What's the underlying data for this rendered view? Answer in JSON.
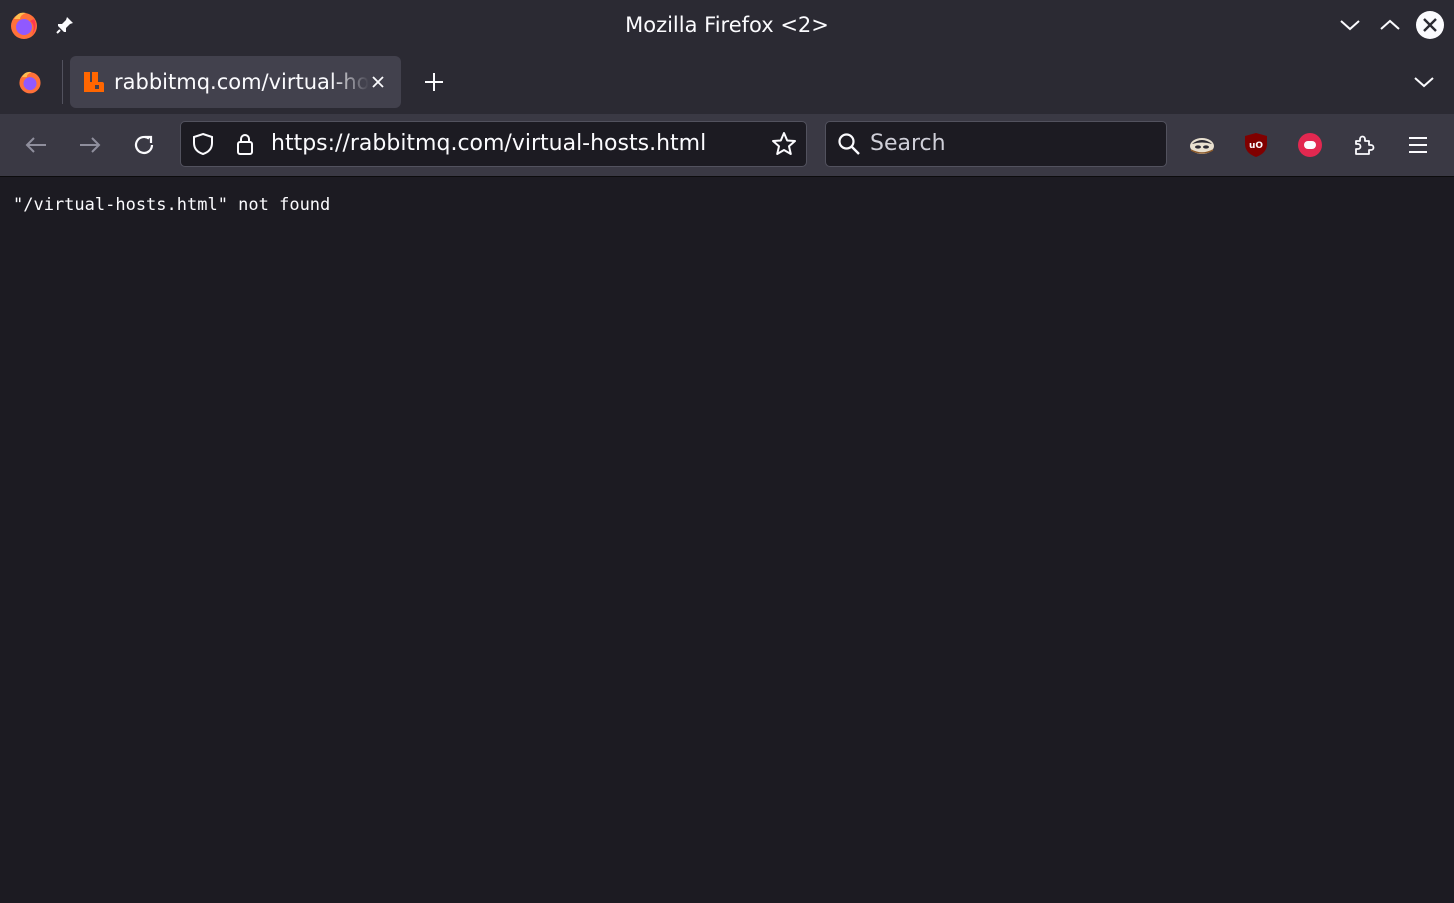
{
  "window": {
    "title": "Mozilla Firefox <2>"
  },
  "tabs": [
    {
      "label": "rabbitmq.com/virtual-hosts.html",
      "active": true
    }
  ],
  "navbar": {
    "url": "https://rabbitmq.com/virtual-hosts.html",
    "search_placeholder": "Search"
  },
  "page": {
    "message": "\"/virtual-hosts.html\" not found"
  },
  "colors": {
    "titlebar": "#2b2a33",
    "navbar": "#3a3944",
    "content": "#1c1b22",
    "tab_active": "#42414d",
    "rabbitmq_orange": "#ff6600",
    "ublock_red": "#800000"
  },
  "icons": {
    "extensions": [
      "privacy-badger-icon",
      "ublock-origin-icon",
      "red-toggle-extension-icon",
      "extensions-puzzle-icon"
    ]
  }
}
